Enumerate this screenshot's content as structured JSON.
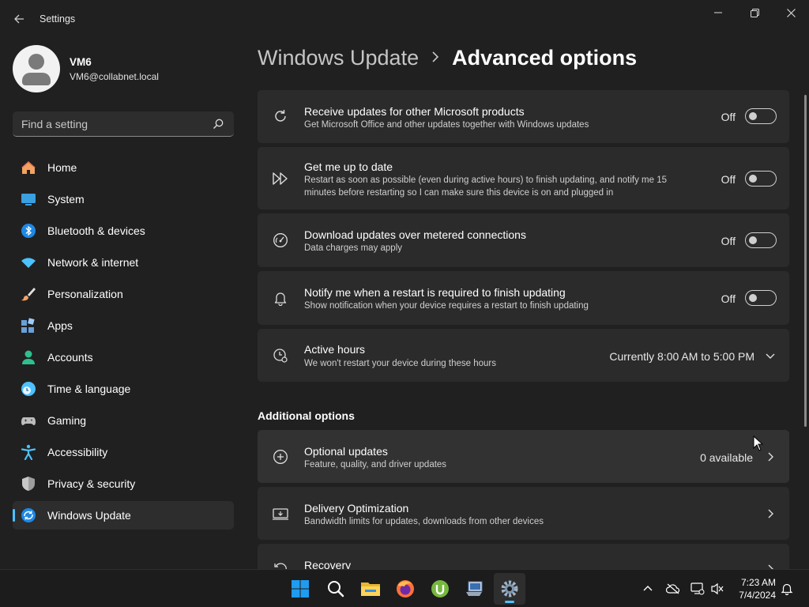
{
  "window": {
    "title": "Settings"
  },
  "profile": {
    "name": "VM6",
    "email": "VM6@collabnet.local"
  },
  "search": {
    "placeholder": "Find a setting"
  },
  "nav": [
    {
      "label": "Home",
      "icon": "home-icon"
    },
    {
      "label": "System",
      "icon": "system-icon"
    },
    {
      "label": "Bluetooth & devices",
      "icon": "bluetooth-icon"
    },
    {
      "label": "Network & internet",
      "icon": "wifi-icon"
    },
    {
      "label": "Personalization",
      "icon": "brush-icon"
    },
    {
      "label": "Apps",
      "icon": "apps-icon"
    },
    {
      "label": "Accounts",
      "icon": "accounts-icon"
    },
    {
      "label": "Time & language",
      "icon": "clock-globe-icon"
    },
    {
      "label": "Gaming",
      "icon": "gamepad-icon"
    },
    {
      "label": "Accessibility",
      "icon": "accessibility-icon"
    },
    {
      "label": "Privacy & security",
      "icon": "shield-icon"
    },
    {
      "label": "Windows Update",
      "icon": "windows-update-icon",
      "active": true
    }
  ],
  "breadcrumb": {
    "parent": "Windows Update",
    "current": "Advanced options"
  },
  "settings": [
    {
      "title": "Receive updates for other Microsoft products",
      "desc": "Get Microsoft Office and other updates together with Windows updates",
      "state": "Off"
    },
    {
      "title": "Get me up to date",
      "desc": "Restart as soon as possible (even during active hours) to finish updating, and notify me 15 minutes before restarting so I can make sure this device is on and plugged in",
      "state": "Off"
    },
    {
      "title": "Download updates over metered connections",
      "desc": "Data charges may apply",
      "state": "Off"
    },
    {
      "title": "Notify me when a restart is required to finish updating",
      "desc": "Show notification when your device requires a restart to finish updating",
      "state": "Off"
    },
    {
      "title": "Active hours",
      "desc": "We won't restart your device during these hours",
      "value": "Currently 8:00 AM to 5:00 PM"
    }
  ],
  "additional": {
    "heading": "Additional options",
    "items": [
      {
        "title": "Optional updates",
        "desc": "Feature, quality, and driver updates",
        "value": "0 available"
      },
      {
        "title": "Delivery Optimization",
        "desc": "Bandwidth limits for updates, downloads from other devices"
      },
      {
        "title": "Recovery",
        "desc": ""
      }
    ]
  },
  "taskbar": {
    "apps": [
      "start-icon",
      "search-icon",
      "file-explorer-icon",
      "firefox-icon",
      "utorrent-icon",
      "remote-desktop-icon",
      "settings-gear-icon"
    ],
    "time": "7:23 AM",
    "date": "7/4/2024"
  },
  "colors": {
    "accent": "#4cc2ff",
    "background": "#202020",
    "card": "#2b2b2b"
  }
}
